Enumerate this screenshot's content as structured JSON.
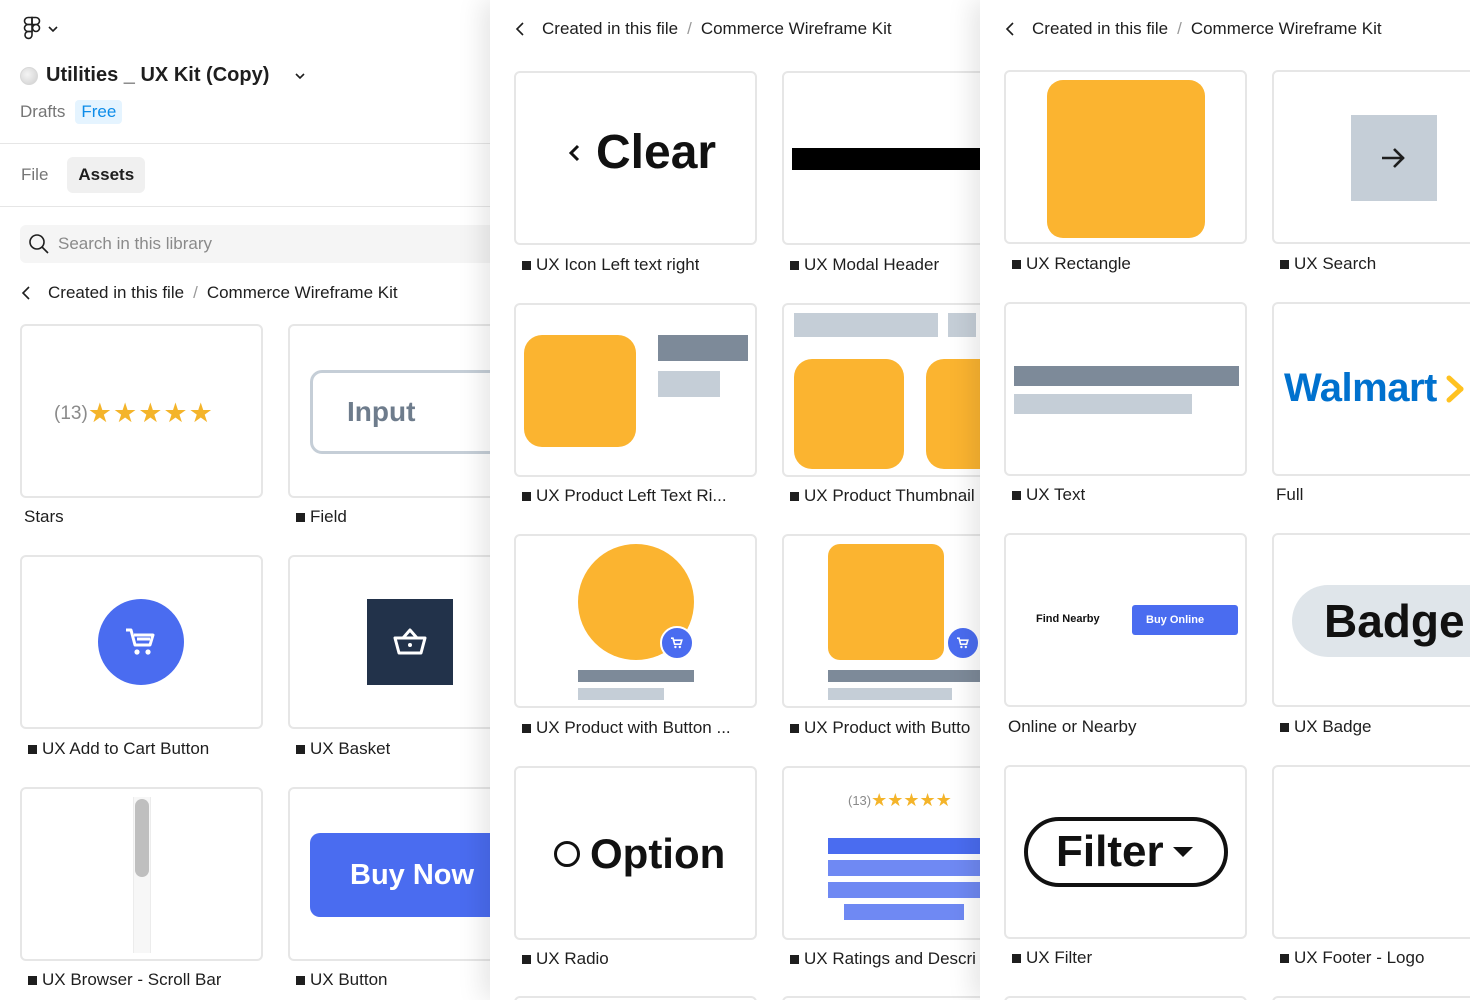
{
  "app": {
    "file_title": "Utilities _ UX Kit (Copy)",
    "location": "Drafts",
    "plan": "Free"
  },
  "tabs": [
    {
      "label": "File",
      "active": false
    },
    {
      "label": "Assets",
      "active": true
    }
  ],
  "search": {
    "placeholder": "Search in this library"
  },
  "breadcrumb": {
    "parent": "Created in this file",
    "separator": "/",
    "current": "Commerce Wireframe Kit"
  },
  "panels": {
    "panel1": {
      "cards": [
        {
          "label": "Stars",
          "component": false
        },
        {
          "label": "Field",
          "component": true
        },
        {
          "label": "UX Add to Cart Button",
          "component": true
        },
        {
          "label": "UX Basket",
          "component": true
        },
        {
          "label": "UX Browser - Scroll Bar",
          "component": true
        },
        {
          "label": "UX Button",
          "component": true
        }
      ]
    },
    "panel2": {
      "cards": [
        {
          "label": "UX Icon Left text right",
          "component": true
        },
        {
          "label": "UX Modal Header",
          "component": true
        },
        {
          "label": "UX Product Left Text Ri...",
          "component": true
        },
        {
          "label": "UX Product Thumbnail",
          "component": true
        },
        {
          "label": "UX Product with Button ...",
          "component": true
        },
        {
          "label": "UX Product with Butto",
          "component": true
        },
        {
          "label": "UX Radio",
          "component": true
        },
        {
          "label": "UX Ratings and Descri",
          "component": true
        }
      ]
    },
    "panel3": {
      "cards": [
        {
          "label": "UX Rectangle",
          "component": true
        },
        {
          "label": "UX Search",
          "component": true
        },
        {
          "label": "UX Text",
          "component": true
        },
        {
          "label": "Full",
          "component": false
        },
        {
          "label": "Online or Nearby",
          "component": false
        },
        {
          "label": "UX Badge",
          "component": true
        },
        {
          "label": "UX Filter",
          "component": true
        },
        {
          "label": "UX Footer - Logo",
          "component": true
        }
      ]
    }
  },
  "previews": {
    "rating_count": "(13)",
    "stars": "★★★★★",
    "input_text": "Input",
    "buy_now_text": "Buy Now",
    "clear_text": "Clear",
    "option_text": "Option",
    "walmart_text": "Walmart",
    "find_nearby_text": "Find Nearby",
    "buy_online_text": "Buy Online",
    "badge_text": "Badge",
    "filter_text": "Filter"
  },
  "colors": {
    "accent_blue": "#4a6cf0",
    "product_yellow": "#fbb430",
    "basket_navy": "#22324a",
    "walmart_blue": "#0071ce",
    "plan_blue": "#0d8ce9"
  },
  "icons": [
    "figma-logo-icon",
    "chevron-down-icon",
    "search-icon",
    "chevron-left-icon",
    "cart-icon",
    "basket-icon",
    "arrow-right-icon",
    "caret-down-icon"
  ]
}
